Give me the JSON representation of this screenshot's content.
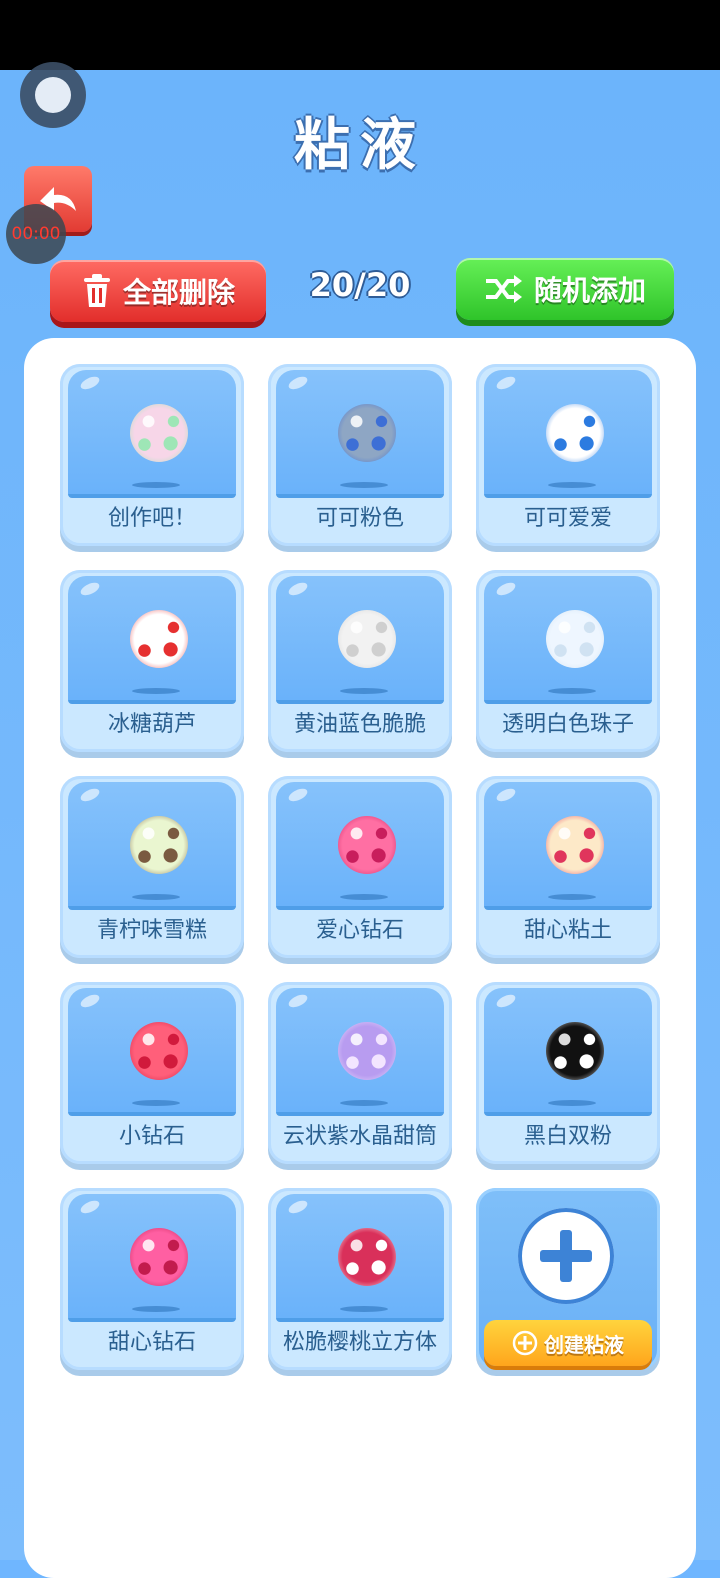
{
  "status": {
    "timer": "00:00"
  },
  "header": {
    "title": "粘液"
  },
  "toolbar": {
    "delete_all_label": "全部删除",
    "count": "20/20",
    "random_add_label": "随机添加"
  },
  "slimes": [
    {
      "name": "创作吧！",
      "colors": [
        "#f7d6e8",
        "#9ee6b6"
      ]
    },
    {
      "name": "可可粉色",
      "colors": [
        "#8ea6c4",
        "#3d6fd6"
      ]
    },
    {
      "name": "可可爱爱",
      "colors": [
        "#ffffff",
        "#2c7be0"
      ]
    },
    {
      "name": "冰糖葫芦",
      "colors": [
        "#ffffff",
        "#e63030"
      ]
    },
    {
      "name": "黄油蓝色脆脆",
      "colors": [
        "#f2f2f2",
        "#cfcfcf"
      ]
    },
    {
      "name": "透明白色珠子",
      "colors": [
        "#eef6ff",
        "#d0e2f2"
      ]
    },
    {
      "name": "青柠味雪糕",
      "colors": [
        "#eaf6d0",
        "#7a5a40"
      ]
    },
    {
      "name": "爱心钻石",
      "colors": [
        "#ff6fa3",
        "#c81e5c"
      ]
    },
    {
      "name": "甜心粘土",
      "colors": [
        "#fde9c8",
        "#e0355c"
      ]
    },
    {
      "name": "小钻石",
      "colors": [
        "#ff5f7a",
        "#d11a3c"
      ]
    },
    {
      "name": "云状紫水晶甜筒",
      "colors": [
        "#b89cf0",
        "#f3e5ff"
      ]
    },
    {
      "name": "黑白双粉",
      "colors": [
        "#111111",
        "#ffffff"
      ]
    },
    {
      "name": "甜心钻石",
      "colors": [
        "#ff5fa2",
        "#c21b4d"
      ]
    },
    {
      "name": "松脆樱桃立方体",
      "colors": [
        "#d9305a",
        "#ffffff"
      ]
    }
  ],
  "create": {
    "label": "创建粘液",
    "icon": "plus-icon"
  }
}
